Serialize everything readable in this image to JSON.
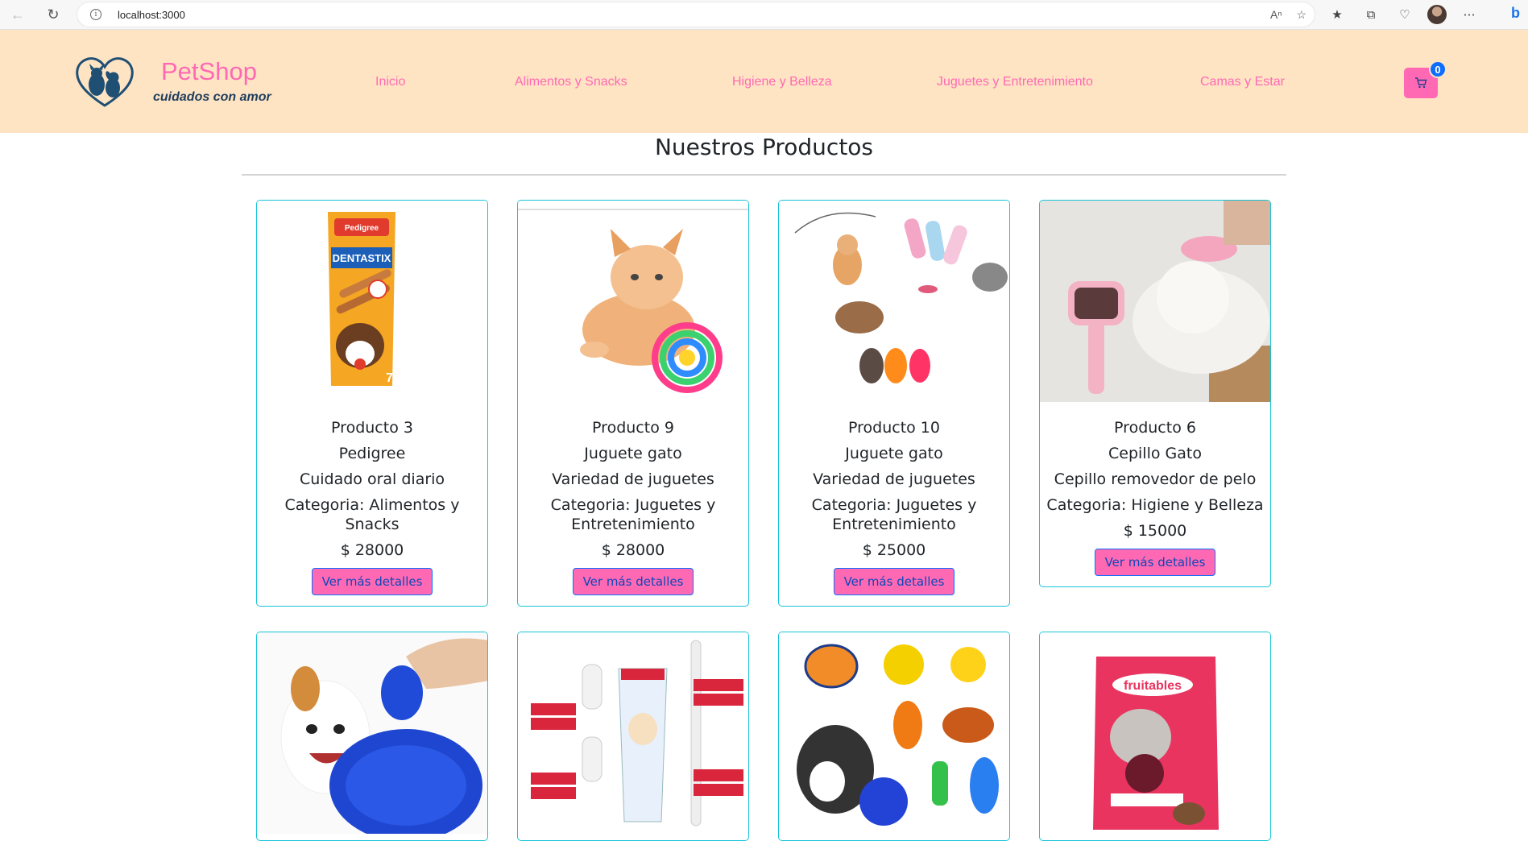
{
  "browser": {
    "url": "localhost:3000"
  },
  "header": {
    "brand_name": "PetShop",
    "brand_tagline": "cuidados con amor",
    "nav": [
      {
        "label": "Inicio"
      },
      {
        "label": "Alimentos y Snacks"
      },
      {
        "label": "Higiene y Belleza"
      },
      {
        "label": "Juguetes y Entretenimiento"
      },
      {
        "label": "Camas y Estar"
      }
    ],
    "cart_count": "0"
  },
  "main": {
    "title": "Nuestros Productos",
    "button_label": "Ver más detalles",
    "products": [
      {
        "id_label": "Producto 3",
        "name": "Pedigree",
        "description": "Cuidado oral diario",
        "category": "Categoria: Alimentos y Snacks",
        "price": "$ 28000",
        "image": "dentastix-package"
      },
      {
        "id_label": "Producto 9",
        "name": "Juguete gato",
        "description": "Variedad de juguetes",
        "category": "Categoria: Juguetes y Entretenimiento",
        "price": "$ 28000",
        "image": "kitten-with-ball"
      },
      {
        "id_label": "Producto 10",
        "name": "Juguete gato",
        "description": "Variedad de juguetes",
        "category": "Categoria: Juguetes y Entretenimiento",
        "price": "$ 25000",
        "image": "cat-toys-assortment"
      },
      {
        "id_label": "Producto 6",
        "name": "Cepillo Gato",
        "description": "Cepillo removedor de pelo",
        "category": "Categoria: Higiene y Belleza",
        "price": "$ 15000",
        "image": "cat-brush"
      },
      {
        "image": "dog-grooming-glove"
      },
      {
        "image": "toothpaste-kit"
      },
      {
        "image": "dog-toys-set"
      },
      {
        "image": "fruitables-treats"
      }
    ]
  },
  "colors": {
    "header_bg": "#ffe4c4",
    "accent_pink": "#ff69b4",
    "card_border": "#17c4d8",
    "badge_blue": "#0d6efd"
  }
}
